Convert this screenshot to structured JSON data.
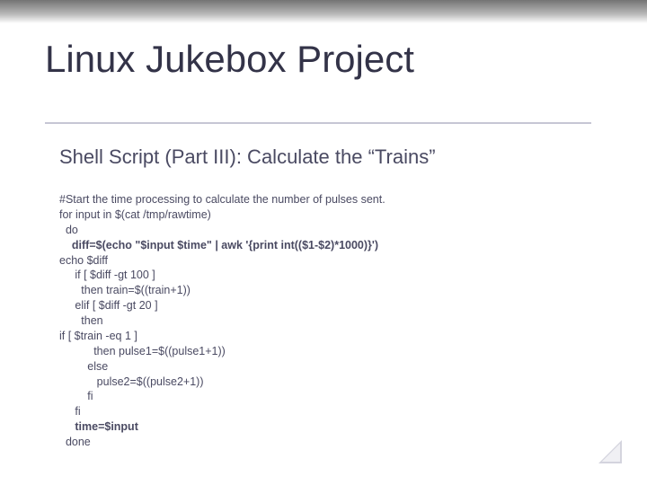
{
  "title": "Linux Jukebox Project",
  "subtitle": "Shell Script (Part III): Calculate the “Trains”",
  "code": {
    "l01": "#Start the time processing to calculate the number of pulses sent.",
    "l02": "for input in $(cat /tmp/rawtime)",
    "l03": "  do",
    "l04a": "    diff=$(echo \"$input $time\" | awk '{print int(($1-$2)*1000)}')",
    "l05": "echo $diff",
    "l06": "     if [ $diff -gt 100 ]",
    "l07": "       then train=$((train+1))",
    "l08": "     elif [ $diff -gt 20 ]",
    "l09": "       then",
    "l10": "if [ $train -eq 1 ]",
    "l11": "           then pulse1=$((pulse1+1))",
    "l12": "         else",
    "l13": "            pulse2=$((pulse2+1))",
    "l14": "         fi",
    "l15": "     fi",
    "l16a": "     time=$input",
    "l17": "  done"
  }
}
